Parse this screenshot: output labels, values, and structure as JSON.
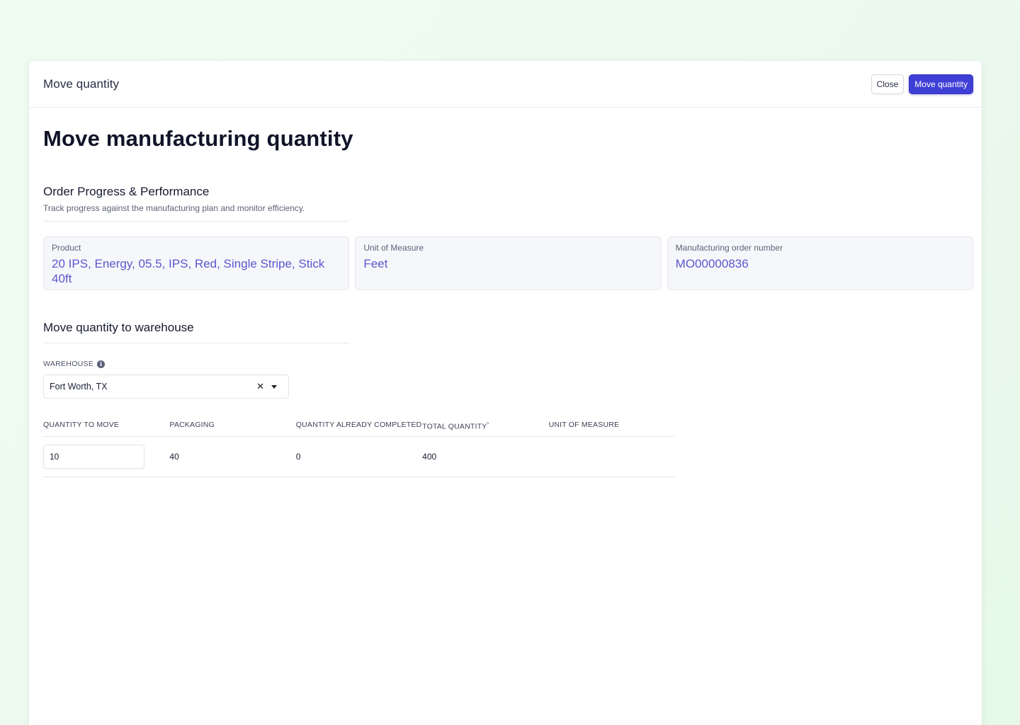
{
  "header": {
    "title": "Move quantity",
    "close_label": "Close",
    "submit_label": "Move quantity"
  },
  "page_title": "Move manufacturing quantity",
  "progress_section": {
    "title": "Order Progress & Performance",
    "description": "Track progress against the manufacturing plan and monitor efficiency.",
    "cards": [
      {
        "label": "Product",
        "value": "20 IPS, Energy, 05.5, IPS, Red, Single Stripe, Stick 40ft"
      },
      {
        "label": "Unit of Measure",
        "value": "Feet"
      },
      {
        "label": "Manufacturing order number",
        "value": "MO00000836"
      }
    ]
  },
  "move_section": {
    "title": "Move quantity to warehouse",
    "warehouse_label": "WAREHOUSE",
    "warehouse_value": "Fort Worth, TX",
    "table": {
      "headers": [
        "QUANTITY TO MOVE",
        "PACKAGING",
        "QUANTITY ALREADY COMPLETED",
        "TOTAL QUANTITY",
        "UNIT OF MEASURE"
      ],
      "total_quantity_marker": "*",
      "row": {
        "quantity_to_move": "10",
        "packaging": "40",
        "quantity_already_completed": "0",
        "total_quantity": "400",
        "unit_of_measure": ""
      }
    }
  },
  "colors": {
    "primary": "#3f3fd6",
    "value_text": "#5b57cf",
    "card_bg": "#f6f7fa"
  }
}
